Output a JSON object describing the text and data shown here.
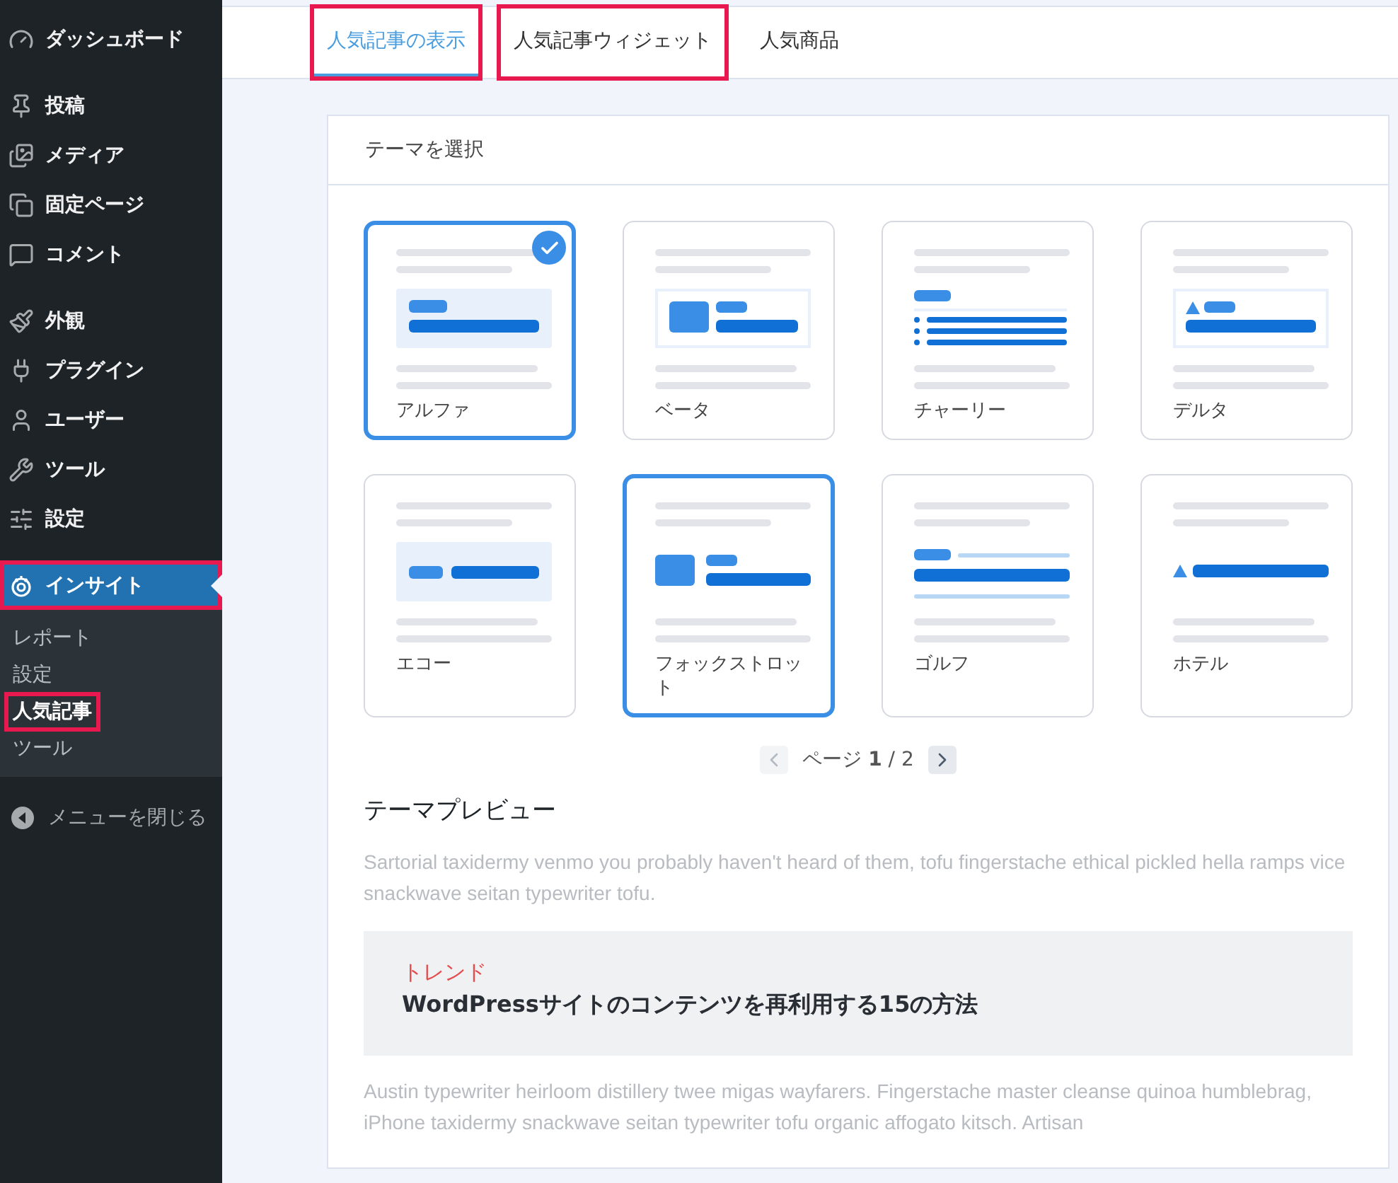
{
  "sidebar": {
    "groups": [
      {
        "items": [
          {
            "label": "ダッシュボード",
            "selected": false,
            "highlighted": false
          }
        ]
      },
      {
        "items": [
          {
            "label": "投稿",
            "selected": false,
            "highlighted": false
          },
          {
            "label": "メディア",
            "selected": false,
            "highlighted": false
          },
          {
            "label": "固定ページ",
            "selected": false,
            "highlighted": false
          },
          {
            "label": "コメント",
            "selected": false,
            "highlighted": false
          }
        ]
      },
      {
        "items": [
          {
            "label": "外観",
            "selected": false,
            "highlighted": false
          },
          {
            "label": "プラグイン",
            "selected": false,
            "highlighted": false
          },
          {
            "label": "ユーザー",
            "selected": false,
            "highlighted": false
          },
          {
            "label": "ツール",
            "selected": false,
            "highlighted": false
          },
          {
            "label": "設定",
            "selected": false,
            "highlighted": false
          }
        ]
      },
      {
        "items": [
          {
            "label": "インサイト",
            "selected": true,
            "highlighted": true,
            "children": [
              {
                "label": "レポート",
                "selected": false,
                "highlighted": false
              },
              {
                "label": "設定",
                "selected": false,
                "highlighted": false
              },
              {
                "label": "人気記事",
                "selected": true,
                "highlighted": true
              },
              {
                "label": "ツール",
                "selected": false,
                "highlighted": false
              }
            ]
          }
        ]
      }
    ],
    "collapse_label": "メニューを閉じる"
  },
  "tabs": [
    {
      "label": "人気記事の表示",
      "selected": true,
      "highlighted": true
    },
    {
      "label": "人気記事ウィジェット",
      "selected": false,
      "highlighted": true
    },
    {
      "label": "人気商品",
      "selected": false,
      "highlighted": false
    }
  ],
  "theme_picker": {
    "title": "テーマを選択",
    "themes": [
      {
        "label": "アルファ",
        "kind": "alpha",
        "selected": true,
        "checked": true
      },
      {
        "label": "ベータ",
        "kind": "beta",
        "selected": false,
        "checked": false
      },
      {
        "label": "チャーリー",
        "kind": "charlie",
        "selected": false,
        "checked": false
      },
      {
        "label": "デルタ",
        "kind": "delta",
        "selected": false,
        "checked": false
      },
      {
        "label": "エコー",
        "kind": "echo",
        "selected": false,
        "checked": false
      },
      {
        "label": "フォックストロット",
        "kind": "foxtrot",
        "selected": true,
        "checked": false
      },
      {
        "label": "ゴルフ",
        "kind": "golf",
        "selected": false,
        "checked": false
      },
      {
        "label": "ホテル",
        "kind": "hotel",
        "selected": false,
        "checked": false
      }
    ],
    "pagination": {
      "text": "ページ **1** / 2",
      "prev_disabled": true,
      "next_disabled": false
    }
  },
  "preview": {
    "title": "テーマプレビュー",
    "paragraph_1": "Sartorial taxidermy venmo you probably haven't heard of them, tofu fingerstache ethical pickled hella ramps vice snackwave seitan typewriter tofu.",
    "box": {
      "label": "トレンド",
      "headline": "WordPressサイトのコンテンツを再利用する15の方法"
    },
    "paragraph_2": "Austin typewriter heirloom distillery twee migas wayfarers. Fingerstache master cleanse quinoa humblebrag, iPhone taxidermy snackwave seitan typewriter tofu organic affogato kitsch. Artisan"
  }
}
